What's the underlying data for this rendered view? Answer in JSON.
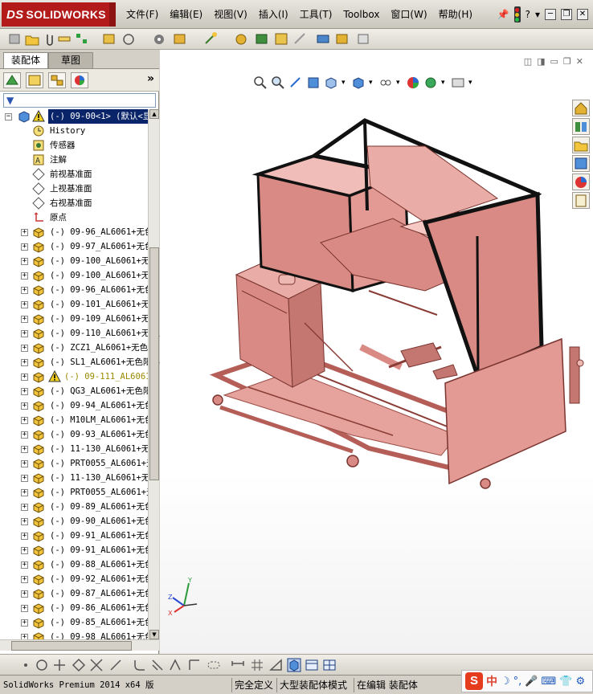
{
  "app": {
    "logo_ds": "DS",
    "logo_text": "SOLIDWORKS"
  },
  "menu": [
    "文件(F)",
    "编辑(E)",
    "视图(V)",
    "插入(I)",
    "工具(T)",
    "Toolbox",
    "窗口(W)",
    "帮助(H)"
  ],
  "window_controls": {
    "help": "?",
    "minimize": "─",
    "restore": "❐",
    "close": "✕"
  },
  "panel": {
    "tabs": [
      "装配体",
      "草图"
    ],
    "more": "»",
    "filter_icon": "▼"
  },
  "tree": {
    "root": "(-) 09-00<1> (默认<显",
    "system": [
      "History",
      "传感器",
      "注解",
      "前视基准面",
      "上视基准面",
      "右视基准面",
      "原点"
    ],
    "parts": [
      {
        "label": "(-) 09-96_AL6061+无色",
        "warn": false
      },
      {
        "label": "(-) 09-97_AL6061+无色",
        "warn": false
      },
      {
        "label": "(-) 09-100_AL6061+无",
        "warn": false
      },
      {
        "label": "(-) 09-100_AL6061+无",
        "warn": false
      },
      {
        "label": "(-) 09-96_AL6061+无色",
        "warn": false
      },
      {
        "label": "(-) 09-101_AL6061+无",
        "warn": false
      },
      {
        "label": "(-) 09-109_AL6061+无",
        "warn": false
      },
      {
        "label": "(-) 09-110_AL6061+无",
        "warn": false
      },
      {
        "label": "(-) ZCZ1_AL6061+无色",
        "warn": false
      },
      {
        "label": "(-) SL1_AL6061+无色阳",
        "warn": false
      },
      {
        "label": "(-) 09-111_AL6061",
        "warn": true
      },
      {
        "label": "(-) QG3_AL6061+无色阳",
        "warn": false
      },
      {
        "label": "(-) 09-94_AL6061+无色",
        "warn": false
      },
      {
        "label": "(-) M10LM_AL6061+无色",
        "warn": false
      },
      {
        "label": "(-) 09-93_AL6061+无色",
        "warn": false
      },
      {
        "label": "(-) 11-130_AL6061+无",
        "warn": false
      },
      {
        "label": "(-) PRT0055_AL6061+无",
        "warn": false
      },
      {
        "label": "(-) 11-130_AL6061+无",
        "warn": false
      },
      {
        "label": "(-) PRT0055_AL6061+无",
        "warn": false
      },
      {
        "label": "(-) 09-89_AL6061+无色",
        "warn": false
      },
      {
        "label": "(-) 09-90_AL6061+无色",
        "warn": false
      },
      {
        "label": "(-) 09-91_AL6061+无色",
        "warn": false
      },
      {
        "label": "(-) 09-91_AL6061+无色",
        "warn": false
      },
      {
        "label": "(-) 09-88_AL6061+无色",
        "warn": false
      },
      {
        "label": "(-) 09-92_AL6061+无色",
        "warn": false
      },
      {
        "label": "(-) 09-87_AL6061+无色",
        "warn": false
      },
      {
        "label": "(-) 09-86_AL6061+无色",
        "warn": false
      },
      {
        "label": "(-) 09-85_AL6061+无色",
        "warn": false
      },
      {
        "label": "(-) 09-98_AL6061+无色",
        "warn": false
      }
    ]
  },
  "viewport": {
    "triad": {
      "x": "X",
      "y": "Y",
      "z": "Z"
    },
    "model_color": "#d98a84",
    "frame_color": "#111111"
  },
  "status": {
    "product": "SolidWorks Premium 2014 x64 版",
    "items": [
      "完全定义",
      "大型装配体模式",
      "在编辑 装配体"
    ]
  },
  "ime": {
    "logo": "S",
    "mode": "中",
    "moon": "☽",
    "punct": "°,",
    "mic": "🎤",
    "keyboard": "⌨",
    "skin": "👕",
    "tools": "⚙"
  }
}
